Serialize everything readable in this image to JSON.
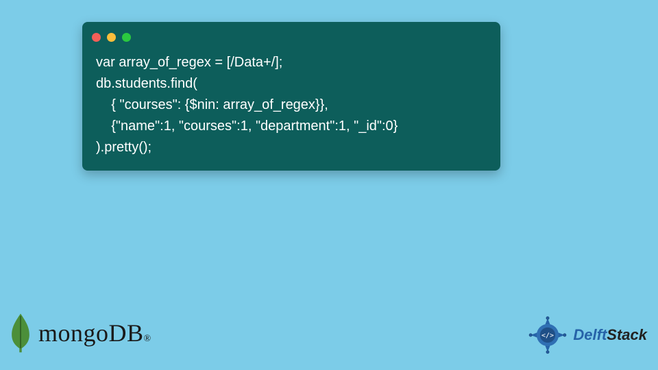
{
  "code": {
    "line1": "var array_of_regex = [/Data+/];",
    "line2": "db.students.find(",
    "line3": "    { \"courses\": {$nin: array_of_regex}},",
    "line4": "    {\"name\":1, \"courses\":1, \"department\":1, \"_id\":0}",
    "line5": ").pretty();"
  },
  "footer": {
    "mongo_label": "mongoDB",
    "mongo_trademark": "®",
    "delft_part1": "Delft",
    "delft_part2": "Stack"
  },
  "colors": {
    "background": "#7ccce8",
    "code_bg": "#0d5e5b",
    "code_text": "#ffffff",
    "accent_blue": "#2663a8",
    "leaf_green": "#4c8f3a"
  }
}
